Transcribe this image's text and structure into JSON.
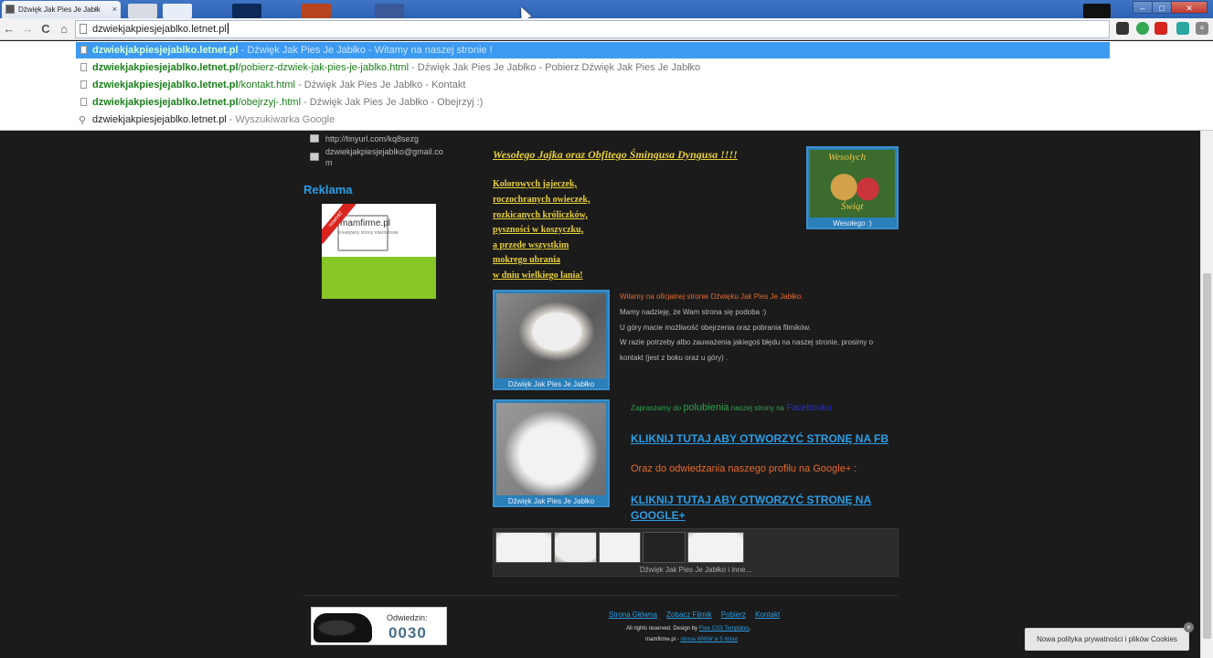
{
  "browser": {
    "tab_title": "Dźwięk Jak Pies Je Jabłk",
    "tab_close": "×",
    "url": "dzwiekjakpiesjejablko.letnet.pl",
    "window_controls": [
      "–",
      "□",
      "✕"
    ],
    "nav": {
      "back": "←",
      "forward": "→",
      "reload": "C",
      "home": "⌂"
    }
  },
  "suggestions": [
    {
      "domain": "dzwiekjakpiesjejablko.letnet.pl",
      "path": "",
      "desc": " - Dźwięk Jak Pies Je Jabłko - Witamy na naszej stronie !",
      "selected": true
    },
    {
      "domain": "dzwiekjakpiesjejablko.letnet.pl",
      "path": "/pobierz-dzwiek-jak-pies-je-jablko.html",
      "desc": " - Dźwięk Jak Pies Je Jabłko - Pobierz Dźwięk Jak Pies Je Jabłko"
    },
    {
      "domain": "dzwiekjakpiesjejablko.letnet.pl",
      "path": "/kontakt.html",
      "desc": " - Dźwięk Jak Pies Je Jabłko - Kontakt"
    },
    {
      "domain": "dzwiekjakpiesjejablko.letnet.pl",
      "path": "/obejrzyj-.html",
      "desc": " - Dźwięk Jak Pies Je Jabłko - Obejrzyj :)"
    }
  ],
  "search_suggestion": {
    "query": "dzwiekjakpiesjejablko.letnet.pl",
    "engine": " - Wyszukiwarka Google"
  },
  "sidebar": {
    "link": "http://tinyurl.com/kq8sezg",
    "email_line1": "dzwiekjakpiesjejablko@gmail.co",
    "email_line2": "m",
    "reklama": "Reklama",
    "ad_title": "mamfirme.pl",
    "ad_sub": "Kreatywny strony internetowe",
    "ad_ribbon": "nowość"
  },
  "easter": {
    "title": "Wesołego Jajka oraz Obfitego Śmingusa Dyngusa !!!!",
    "poem": [
      "Kolorowych jajeczek,",
      "roczochranych owieczek,",
      "rozkicanych króliczków,",
      "pyszności w koszyczku,",
      "a przede wszystkim",
      "mokrego ubrania",
      "w dniu wielkiego lania!"
    ],
    "image_text_1": "Wesołych",
    "image_text_2": "Świąt",
    "image_caption": "Wesołego :)"
  },
  "welcome": {
    "line1": "Witamy na oficjalnej stronie Dźwięku Jak Pies Je Jabłko.",
    "line2": "Mamy nadzieję, że Wam strona się podoba :)",
    "line3": "U góry macie możliwość obejrzenia oraz pobrania filmików.",
    "line4": "W razie potrzeby albo zauważenia jakiegoś błędu na naszej stronie, prosimy o",
    "line5": "kontakt (jest z boku oraz u góry) .",
    "photo_caption": "Dźwięk Jak Pies Je Jabłko"
  },
  "social": {
    "intro_a": "Zapraszamy do ",
    "intro_b": "polubienia",
    "intro_c": " naszej strony na ",
    "intro_d": "Facebooku",
    "fb_link": "KLIKNIJ TUTAJ ABY OTWORZYĆ STRONĘ NA FB",
    "gplus_intro": "Oraz do odwiedzania naszego profilu na Google+ :",
    "gplus_link_1": "KLIKNIJ TUTAJ ABY OTWORZYĆ STRONĘ NA",
    "gplus_link_2": "GOOGLE+",
    "photo_caption": "Dźwięk Jak Pies Je Jabłko"
  },
  "gallery": {
    "caption": "Dźwięk Jak Pies Je Jabłko i inne..."
  },
  "footer": {
    "counter_label": "Odwiedzin:",
    "counter_value": "0030",
    "nav": [
      "Strona Główna",
      "Zobacz Filmik",
      "Pobierz",
      "Kontakt"
    ],
    "rights_a": "All rights reserved. Design by ",
    "rights_b": "Free CSS Templates",
    "rights_c": ".",
    "mam_a": "mamfirme.pl - ",
    "mam_b": "strona WWW w 5 minut"
  },
  "cookie": {
    "text": "Nowa polityka prywatności i plików Cookies",
    "close": "×"
  }
}
